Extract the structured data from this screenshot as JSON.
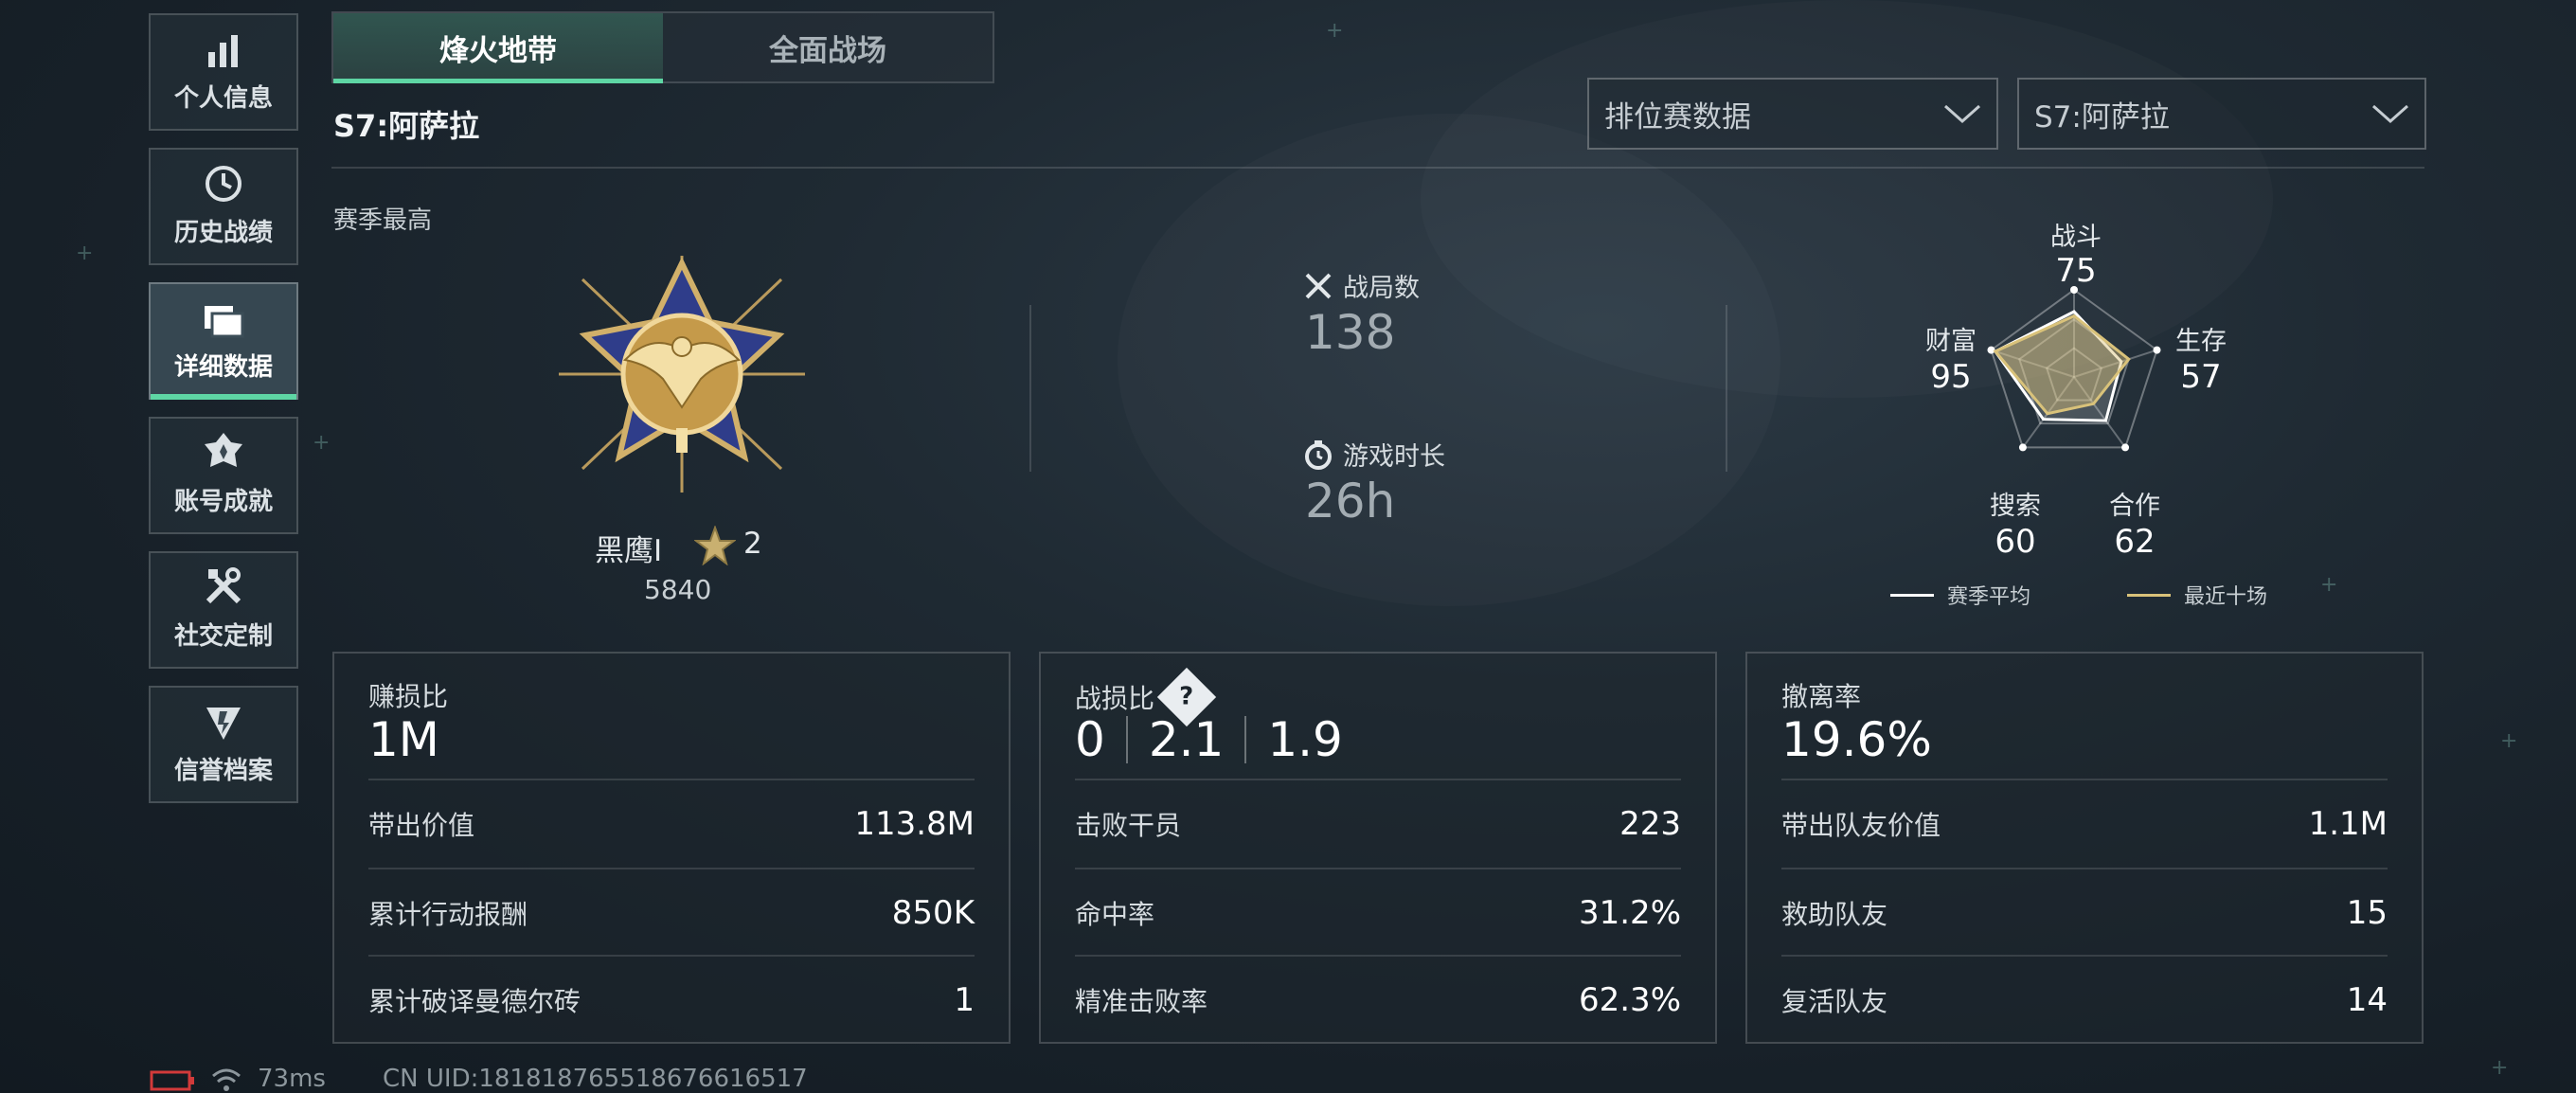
{
  "sidebar": {
    "items": [
      {
        "label": "个人信息",
        "icon": "bar-chart-icon"
      },
      {
        "label": "历史战绩",
        "icon": "history-clock-icon"
      },
      {
        "label": "详细数据",
        "icon": "folders-icon",
        "active": true
      },
      {
        "label": "账号成就",
        "icon": "achievement-icon"
      },
      {
        "label": "社交定制",
        "icon": "tools-icon"
      },
      {
        "label": "信誉档案",
        "icon": "reputation-icon"
      }
    ]
  },
  "tabs": [
    {
      "label": "烽火地带",
      "active": true
    },
    {
      "label": "全面战场",
      "active": false
    }
  ],
  "season_title": "S7:阿萨拉",
  "filters": {
    "mode": "排位赛数据",
    "season": "S7:阿萨拉"
  },
  "season_best": {
    "label": "赛季最高",
    "rank_name": "黑鹰Ⅰ",
    "stars": "2",
    "score": "5840"
  },
  "overview": {
    "matches_label": "战局数",
    "matches_value": "138",
    "playtime_label": "游戏时长",
    "playtime_value": "26h"
  },
  "radar": {
    "axes": [
      {
        "label": "战斗",
        "value": "75"
      },
      {
        "label": "生存",
        "value": "57"
      },
      {
        "label": "合作",
        "value": "62"
      },
      {
        "label": "搜索",
        "value": "60"
      },
      {
        "label": "财富",
        "value": "95"
      }
    ],
    "legend": [
      {
        "label": "赛季平均",
        "color": "#ffffff"
      },
      {
        "label": "最近十场",
        "color": "#d9c27a"
      }
    ],
    "season_avg": [
      75,
      57,
      62,
      60,
      95
    ],
    "recent_ten": [
      70,
      66,
      38,
      52,
      95
    ]
  },
  "cards": {
    "profit": {
      "title": "赚损比",
      "big": "1M",
      "rows": [
        {
          "key": "带出价值",
          "value": "113.8M"
        },
        {
          "key": "累计行动报酬",
          "value": "850K"
        },
        {
          "key": "累计破译曼德尔砖",
          "value": "1"
        }
      ]
    },
    "combat": {
      "title": "战损比",
      "big": [
        "0",
        "2.1",
        "1.9"
      ],
      "rows": [
        {
          "key": "击败干员",
          "value": "223"
        },
        {
          "key": "命中率",
          "value": "31.2%"
        },
        {
          "key": "精准击败率",
          "value": "62.3%"
        }
      ]
    },
    "extract": {
      "title": "撤离率",
      "big": "19.6%",
      "rows": [
        {
          "key": "带出队友价值",
          "value": "1.1M"
        },
        {
          "key": "救助队友",
          "value": "15"
        },
        {
          "key": "复活队友",
          "value": "14"
        }
      ]
    }
  },
  "status": {
    "ping": "73ms",
    "uid": "CN UID:18181876551867661651​7"
  },
  "colors": {
    "accent": "#5ed6a4",
    "gold": "#d9c27a"
  }
}
